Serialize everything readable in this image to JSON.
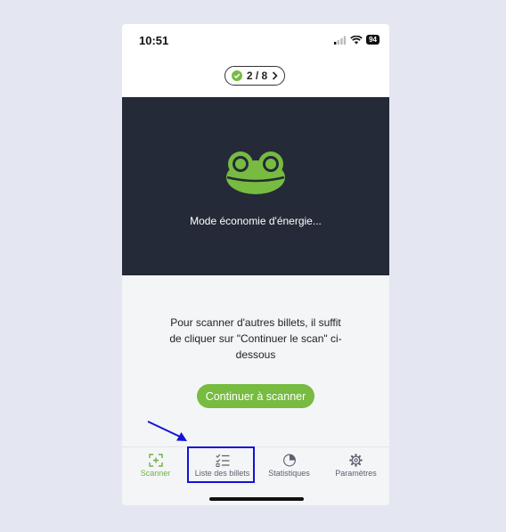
{
  "status_bar": {
    "time": "10:51",
    "battery": "94",
    "icons": [
      "cellular-signal-icon",
      "wifi-icon",
      "battery-icon"
    ]
  },
  "progress": {
    "count": "2 / 8",
    "status_icon": "check-circle-icon",
    "chevron_icon": "chevron-right-icon"
  },
  "camera_panel": {
    "logo": "frog-logo-icon",
    "message": "Mode économie d'énergie..."
  },
  "info": {
    "text": "Pour scanner d'autres billets, il suffit de cliquer sur \"Continuer le scan\" ci-dessous"
  },
  "continue_button": {
    "label": "Continuer à scanner"
  },
  "tabs": [
    {
      "label": "Scanner",
      "icon": "scan-icon",
      "active": true
    },
    {
      "label": "Liste des billets",
      "icon": "checklist-icon",
      "active": false
    },
    {
      "label": "Statistiques",
      "icon": "pie-chart-icon",
      "active": false
    },
    {
      "label": "Paramètres",
      "icon": "gear-icon",
      "active": false
    }
  ],
  "colors": {
    "accent_green": "#77bb41",
    "dark_panel": "#242a37",
    "annotation_blue": "#1313d8"
  }
}
